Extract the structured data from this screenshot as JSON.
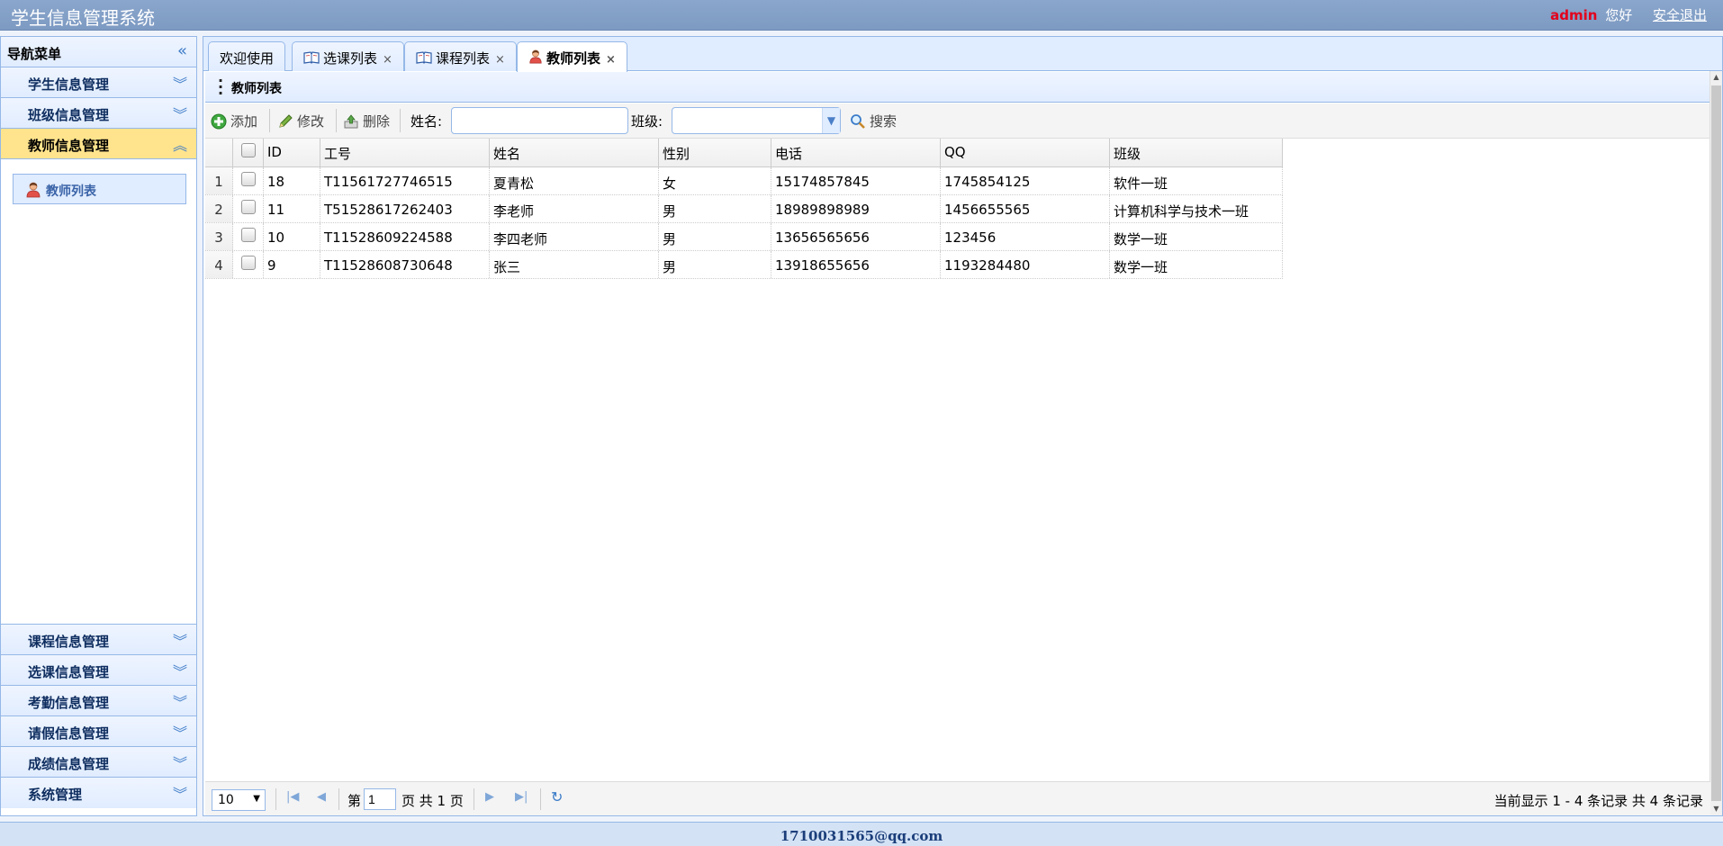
{
  "header": {
    "app_title": "学生信息管理系统",
    "user": "admin",
    "greeting": "您好",
    "logout": "安全退出"
  },
  "sidebar": {
    "title": "导航菜单",
    "top_items": [
      {
        "label": "学生信息管理"
      },
      {
        "label": "班级信息管理"
      },
      {
        "label": "教师信息管理"
      }
    ],
    "active_sub_item": "教师列表",
    "bottom_items": [
      {
        "label": "课程信息管理"
      },
      {
        "label": "选课信息管理"
      },
      {
        "label": "考勤信息管理"
      },
      {
        "label": "请假信息管理"
      },
      {
        "label": "成绩信息管理"
      },
      {
        "label": "系统管理"
      }
    ]
  },
  "tabs": [
    {
      "label": "欢迎使用"
    },
    {
      "label": "选课列表"
    },
    {
      "label": "课程列表"
    },
    {
      "label": "教师列表"
    }
  ],
  "panel_title": "教师列表",
  "toolbar": {
    "add": "添加",
    "edit": "修改",
    "delete": "删除",
    "name_label": "姓名:",
    "name_value": "",
    "class_label": "班级:",
    "class_value": "",
    "search": "搜索"
  },
  "grid": {
    "columns": [
      "ID",
      "工号",
      "姓名",
      "性别",
      "电话",
      "QQ",
      "班级"
    ],
    "rows": [
      {
        "n": "1",
        "id": "18",
        "sn": "T11561727746515",
        "name": "夏青松",
        "sex": "女",
        "phone": "15174857845",
        "qq": "1745854125",
        "clazz": "软件一班"
      },
      {
        "n": "2",
        "id": "11",
        "sn": "T51528617262403",
        "name": "李老师",
        "sex": "男",
        "phone": "18989898989",
        "qq": "1456655565",
        "clazz": "计算机科学与技术一班"
      },
      {
        "n": "3",
        "id": "10",
        "sn": "T11528609224588",
        "name": "李四老师",
        "sex": "男",
        "phone": "13656565656",
        "qq": "123456",
        "clazz": "数学一班"
      },
      {
        "n": "4",
        "id": "9",
        "sn": "T11528608730648",
        "name": "张三",
        "sex": "男",
        "phone": "13918655656",
        "qq": "1193284480",
        "clazz": "数学一班"
      }
    ]
  },
  "pager": {
    "page_size": "10",
    "page_prefix": "第",
    "page_number": "1",
    "page_suffix": "页 共 1 页",
    "info": "当前显示 1 - 4 条记录 共 4 条记录"
  },
  "footer": {
    "text": "1710031565@qq.com"
  },
  "colors": {
    "header_bg": "#7d9ac2",
    "accent": "#95b8e7",
    "active_menu": "#ffe48d",
    "admin_red": "#e3001b"
  }
}
